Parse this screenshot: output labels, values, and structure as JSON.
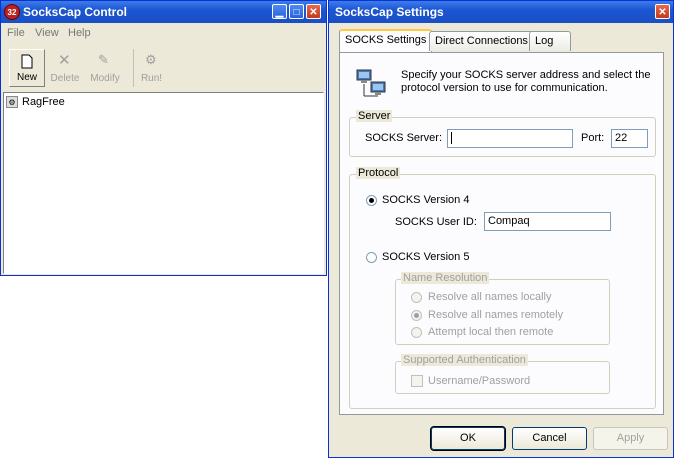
{
  "control_window": {
    "title": "SocksCap Control",
    "app_icon_text": "32",
    "menu": [
      "File",
      "View",
      "Help"
    ],
    "toolbar": [
      {
        "label": "New",
        "enabled": true
      },
      {
        "label": "Delete",
        "enabled": false
      },
      {
        "label": "Modify",
        "enabled": false
      },
      {
        "label": "Run!",
        "enabled": false
      }
    ],
    "list_items": [
      "RagFree"
    ]
  },
  "settings_dialog": {
    "title": "SocksCap Settings",
    "tabs": [
      "SOCKS Settings",
      "Direct Connections",
      "Log"
    ],
    "active_tab": "SOCKS Settings",
    "description": "Specify your SOCKS server address and select the protocol version to use for communication.",
    "server_group": {
      "legend": "Server",
      "server_label": "SOCKS Server:",
      "server_value": "",
      "port_label": "Port:",
      "port_value": "22"
    },
    "protocol_group": {
      "legend": "Protocol",
      "v4_label": "SOCKS Version 4",
      "v4_selected": true,
      "user_id_label": "SOCKS User ID:",
      "user_id_value": "Compaq",
      "v5_label": "SOCKS Version 5",
      "v5_selected": false,
      "name_resolution": {
        "legend": "Name Resolution",
        "options": [
          "Resolve all names locally",
          "Resolve all names remotely",
          "Attempt local then remote"
        ],
        "selected": "Resolve all names remotely"
      },
      "auth": {
        "legend": "Supported Authentication",
        "username_password_label": "Username/Password"
      }
    },
    "buttons": {
      "ok": "OK",
      "cancel": "Cancel",
      "apply": "Apply"
    }
  }
}
